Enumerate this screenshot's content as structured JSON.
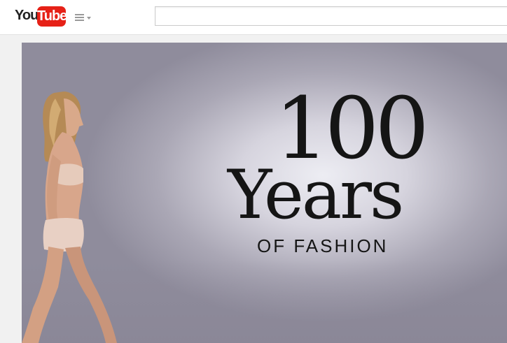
{
  "masthead": {
    "logo_you": "You",
    "logo_tube": "Tube",
    "guide_icon": "hamburger-menu-icon",
    "search_placeholder": ""
  },
  "video": {
    "title_number": "100",
    "title_word": "Years",
    "title_sub": "OF FASHION"
  },
  "colors": {
    "brand_red": "#e62117",
    "masthead_bg": "#ffffff",
    "page_bg": "#f1f1f1",
    "title_text": "#151515"
  }
}
